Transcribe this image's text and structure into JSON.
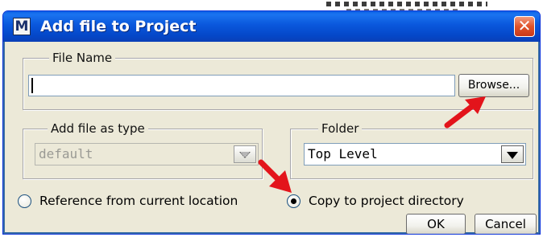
{
  "dialog": {
    "title": "Add file to Project",
    "icon_letter": "M",
    "close_glyph": "✕"
  },
  "file_name": {
    "group_label": "File Name",
    "value": "",
    "browse_label": "Browse..."
  },
  "file_type": {
    "group_label": "Add file as type",
    "selected": "default",
    "enabled": false
  },
  "folder": {
    "group_label": "Folder",
    "selected": "Top Level"
  },
  "location_options": [
    {
      "label": "Reference from current location",
      "checked": false
    },
    {
      "label": "Copy to project directory",
      "checked": true
    }
  ],
  "buttons": {
    "ok": "OK",
    "cancel": "Cancel"
  },
  "colors": {
    "titlebar": "#0a57dc",
    "dialog_bg": "#ece9d8",
    "close_button": "#e0532a",
    "annotation_arrow": "#e3141b"
  },
  "icons": [
    "app-m-icon",
    "close-icon",
    "dropdown-arrow-icon",
    "annotation-arrow-icon"
  ]
}
